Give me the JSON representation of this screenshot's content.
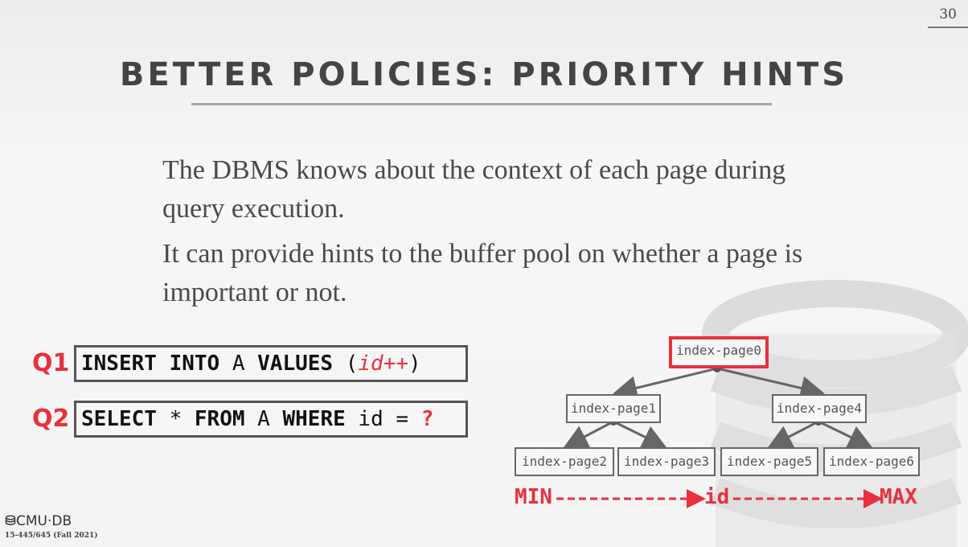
{
  "slide": {
    "number": "30"
  },
  "title": "BETTER POLICIES: PRIORITY HINTS",
  "paragraphs": [
    "The DBMS knows about the context of each page during query execution.",
    "It can provide hints to the buffer pool on whether a page is important or not."
  ],
  "queries": [
    {
      "label": "Q1",
      "parts": {
        "kw1": "INSERT INTO",
        "t1": " A ",
        "kw2": "VALUES",
        "t2": " (",
        "var": "id++",
        "t3": ")"
      }
    },
    {
      "label": "Q2",
      "parts": {
        "kw1": "SELECT",
        "t1": " * ",
        "kw2": "FROM",
        "t2": " A ",
        "kw3": "WHERE",
        "t3": " id = ",
        "q": "?"
      }
    }
  ],
  "tree": {
    "root": "index-page0",
    "level1": [
      "index-page1",
      "index-page4"
    ],
    "leaves": [
      "index-page2",
      "index-page3",
      "index-page5",
      "index-page6"
    ]
  },
  "axis": {
    "min": "MIN",
    "mid": "id",
    "max": "MAX"
  },
  "footer": {
    "logo": "CMU·DB",
    "course": "15-445/645 (Fall 2021)"
  },
  "colors": {
    "accent": "#e8303f",
    "text": "#4a4a4a"
  }
}
